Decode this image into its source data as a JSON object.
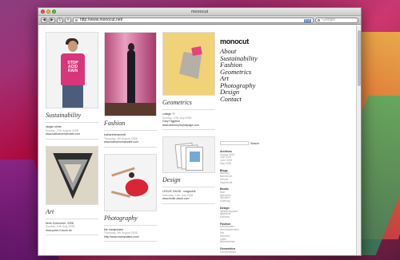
{
  "window": {
    "title": "monocut",
    "url": "http://www.monocut.net/",
    "rss_label": "RSS",
    "search_placeholder": "Google"
  },
  "toolbar": {
    "back": "◀",
    "forward": "▶",
    "reload": "↻",
    "add": "+"
  },
  "colors": {
    "accent": "#d9357a",
    "link": "#222222"
  },
  "posts": {
    "sustainability": {
      "title": "Sustainability",
      "meta1": "slogan shirts",
      "meta2": "Sunday, 17th August 2008",
      "meta3": "www.katharinehamnett.com"
    },
    "art": {
      "title": "Art",
      "meta1": "Iterie Goricorrier, 2008",
      "meta2": "Sunday, 10th Aug 2008",
      "meta3": "www.peter-h-koch.de"
    },
    "fashion": {
      "title": "Fashion",
      "meta1": "katharinehamnett",
      "meta2": "Thursday, 4th August 2008",
      "meta3": "www.katharinehamnett.com"
    },
    "photography": {
      "title": "Photography",
      "meta1": "the manipulator",
      "meta2": "Thursday, 4th August 2008",
      "meta3": "http://www.manipulator.com/"
    },
    "geometrics": {
      "title": "Geometrics",
      "meta1": "collage ??",
      "meta2": "Sunday, 17th July 2008",
      "meta3": "Gary Figgeton",
      "meta4": "www.anthonyheywilpage.com"
    },
    "design": {
      "title": "Design",
      "meta1": "LESLIE DAVID - magazine",
      "meta2": "Saturday, 11th July 2008",
      "meta3": "www.leslie-david.com"
    }
  },
  "sidebar": {
    "logo": "monocut",
    "nav": [
      "About",
      "Sustainability",
      "Fashion",
      "Geometrics",
      "Art",
      "Photography",
      "Design",
      "Contact"
    ],
    "search_button": "Search",
    "sections": [
      {
        "heading": "Archives",
        "items": [
          "August 2008",
          "July 2008",
          "June 2008",
          "May 2008"
        ]
      },
      {
        "heading": "Blogs",
        "items": [
          "fashiony",
          "fashionism",
          "Gelmet",
          "inspirelude"
        ]
      },
      {
        "heading": "Books",
        "items": [
          "seal",
          "geometry",
          "nijhoffen",
          "ordening"
        ]
      },
      {
        "heading": "Design",
        "items": [
          "ulifabesinpapier",
          "gilabelsie",
          "surfaces"
        ]
      },
      {
        "heading": "Fashion",
        "items": [
          "annisionalier",
          "jennerbeatedeck",
          "tule",
          "florpatch",
          "hutee",
          "liebenhalmax"
        ]
      },
      {
        "heading": "Geometrics",
        "items": [
          "somaboratline"
        ]
      }
    ]
  }
}
